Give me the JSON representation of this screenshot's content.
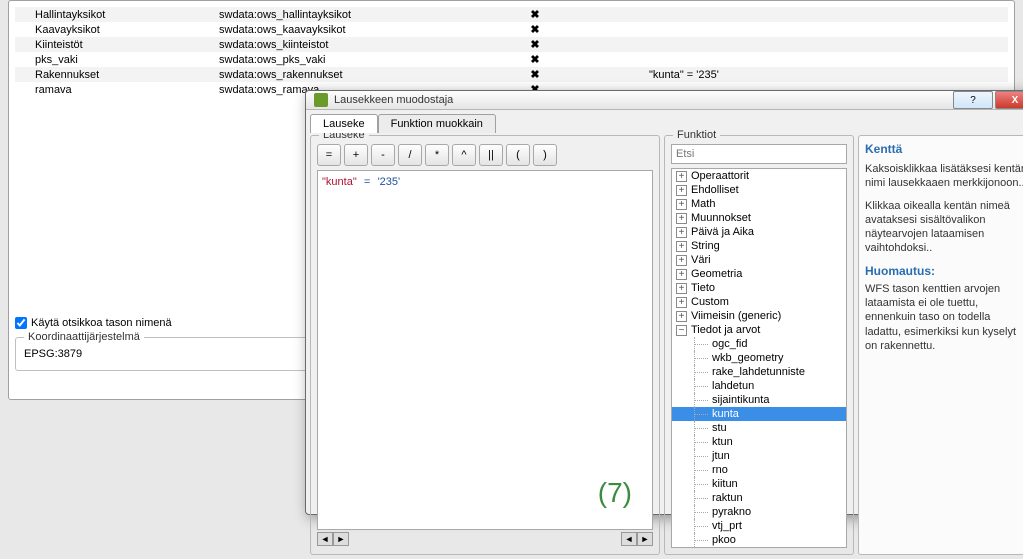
{
  "layers": [
    {
      "name": "Hallintayksikot",
      "src": "swdata:ows_hallintayksikot",
      "mark": "✖",
      "filter": ""
    },
    {
      "name": "Kaavayksikot",
      "src": "swdata:ows_kaavayksikot",
      "mark": "✖",
      "filter": ""
    },
    {
      "name": "Kiinteistöt",
      "src": "swdata:ows_kiinteistot",
      "mark": "✖",
      "filter": ""
    },
    {
      "name": "pks_vaki",
      "src": "swdata:ows_pks_vaki",
      "mark": "✖",
      "filter": ""
    },
    {
      "name": "Rakennukset",
      "src": "swdata:ows_rakennukset",
      "mark": "✖",
      "filter": "\"kunta\" = '235'"
    },
    {
      "name": "ramava",
      "src": "swdata:ows_ramava",
      "mark": "✖",
      "filter": ""
    }
  ],
  "checkbox_label": "Käytä otsikkoa tason nimenä",
  "coord_group": "Koordinaattijärjestelmä",
  "epsg": "EPSG:3879",
  "dialog": {
    "title": "Lausekkeen muodostaja",
    "tabs": {
      "lauseke": "Lauseke",
      "funktio": "Funktion muokkain"
    },
    "left_group": "Lauseke",
    "mid_group": "Funktiot",
    "ops": [
      "=",
      "+",
      "-",
      "/",
      "*",
      "^",
      "||",
      "(",
      ")"
    ],
    "expr": {
      "lhs": "\"kunta\"",
      "op": "=",
      "rhs": "'235'"
    },
    "marker": "(7)",
    "search_placeholder": "Etsi",
    "tree_top": [
      "Operaattorit",
      "Ehdolliset",
      "Math",
      "Muunnokset",
      "Päivä ja Aika",
      "String",
      "Väri",
      "Geometria",
      "Tieto",
      "Custom",
      "Viimeisin (generic)"
    ],
    "tree_expanded": "Tiedot ja arvot",
    "tree_children": [
      "ogc_fid",
      "wkb_geometry",
      "rake_lahdetunniste",
      "lahdetun",
      "sijaintikunta",
      "kunta",
      "stu",
      "ktun",
      "jtun",
      "rno",
      "kiitun",
      "raktun",
      "pyrakno",
      "vtj_prt",
      "pkoo"
    ],
    "selected": "kunta",
    "help": {
      "title": "Kenttä",
      "p1": "Kaksoisklikkaa lisätäksesi kentän nimi lausekkaaen merkkijonoon..",
      "p2": "Klikkaa oikealla kentän nimeä avataksesi sisältövalikon näytearvojen lataamisen vaihtohdoksi..",
      "note_h": "Huomautus:",
      "note": "WFS tason kenttien arvojen lataamista ei ole tuettu, ennenkuin taso on todella ladattu, esimerkiksi kun kyselyt on rakennettu."
    }
  }
}
